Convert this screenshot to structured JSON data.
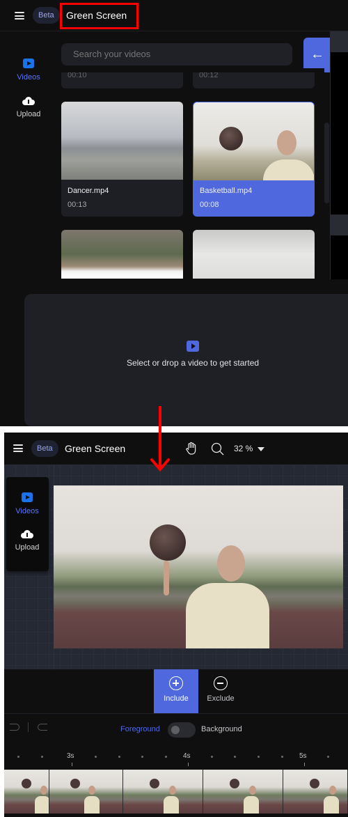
{
  "top_screen": {
    "header": {
      "menu_icon": "hamburger-menu-icon",
      "badge": "Beta",
      "title": "Green Screen"
    },
    "sidebar": {
      "items": [
        {
          "label": "Videos",
          "icon": "video-play-icon",
          "active": true
        },
        {
          "label": "Upload",
          "icon": "cloud-upload-icon",
          "active": false
        }
      ]
    },
    "search": {
      "placeholder": "Search your videos",
      "value": ""
    },
    "back_button": {
      "icon": "arrow-left-icon",
      "glyph": "←"
    },
    "videos": [
      {
        "name": "",
        "duration": "00:10",
        "partial": true
      },
      {
        "name": "",
        "duration": "00:12",
        "partial": true
      },
      {
        "name": "Dancer.mp4",
        "duration": "00:13",
        "selected": false
      },
      {
        "name": "Basketball.mp4",
        "duration": "00:08",
        "selected": true
      },
      {
        "name": "",
        "duration": "",
        "partial": true
      },
      {
        "name": "",
        "duration": "",
        "partial": true
      }
    ],
    "drop_zone": {
      "icon": "video-play-icon",
      "text": "Select or drop a video to get started"
    }
  },
  "bottom_screen": {
    "header": {
      "badge": "Beta",
      "title": "Green Screen",
      "hand_tool": "hand-pan-icon",
      "zoom_tool": "search-zoom-icon",
      "zoom_level": "32 %",
      "zoom_dropdown": "caret-down-icon"
    },
    "sidebar": {
      "items": [
        {
          "label": "Videos",
          "icon": "video-play-icon",
          "active": true
        },
        {
          "label": "Upload",
          "icon": "cloud-upload-icon",
          "active": false
        }
      ]
    },
    "modes": [
      {
        "label": "Include",
        "icon": "plus-circle-icon",
        "active": true
      },
      {
        "label": "Exclude",
        "icon": "minus-circle-icon",
        "active": false
      }
    ],
    "toolbar": {
      "undo_icon": "undo-icon",
      "redo_icon": "redo-icon",
      "foreground_label": "Foreground",
      "background_label": "Background",
      "toggle_state": "foreground"
    },
    "timeline": {
      "ticks": [
        "3s",
        "4s",
        "5s"
      ]
    }
  },
  "colors": {
    "accent": "#5068dd",
    "bg": "#0f0f10",
    "panel": "#1f2026",
    "annotation": "#ff0000"
  }
}
